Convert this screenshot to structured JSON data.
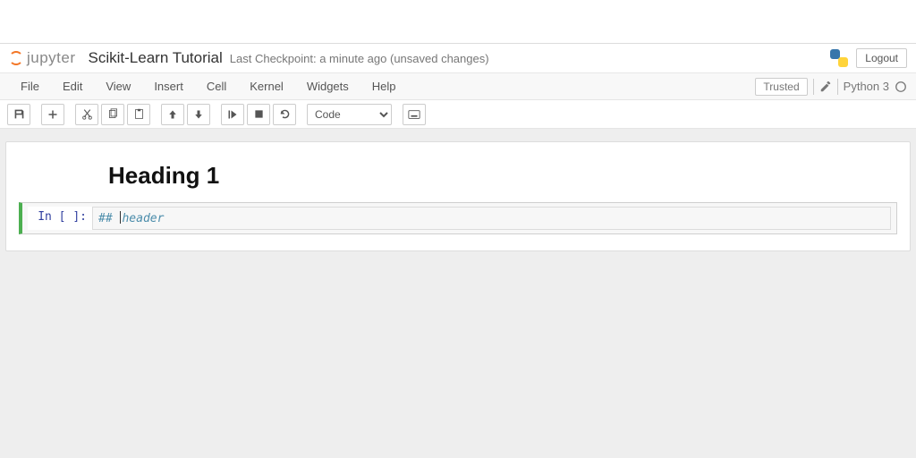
{
  "brand": "jupyter",
  "notebook_title": "Scikit-Learn Tutorial",
  "checkpoint_text": "Last Checkpoint: a minute ago (unsaved changes)",
  "logout_label": "Logout",
  "menu": {
    "file": "File",
    "edit": "Edit",
    "view": "View",
    "insert": "Insert",
    "cell": "Cell",
    "kernel": "Kernel",
    "widgets": "Widgets",
    "help": "Help"
  },
  "trusted_label": "Trusted",
  "kernel_name": "Python 3",
  "cell_type_selected": "Code",
  "rendered_heading": "Heading 1",
  "cell_prompt": "In [ ]:",
  "cell_content_hash": "##",
  "cell_content_text": "header"
}
